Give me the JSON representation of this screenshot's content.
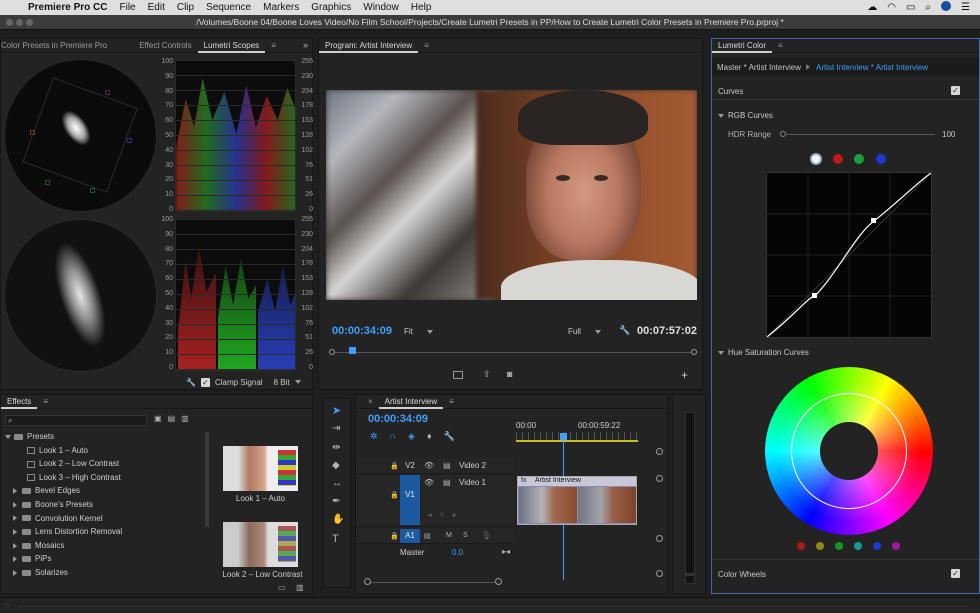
{
  "menubar": {
    "app": "Premiere Pro CC",
    "items": [
      "File",
      "Edit",
      "Clip",
      "Sequence",
      "Markers",
      "Graphics",
      "Window",
      "Help"
    ]
  },
  "titlebar": {
    "path": "/Volumes/Boone 04/Boone Loves Video/No Film School/Projects/Create Lumetri Presets in PP/How to Create Lumetri Color Presets in Premiere Pro.prproj *"
  },
  "scopes": {
    "tabs": [
      "Color Presets in Premiere Pro",
      "Effect Controls",
      "Lumetri Scopes"
    ],
    "scale_left": [
      "100",
      "90",
      "80",
      "70",
      "60",
      "50",
      "40",
      "30",
      "20",
      "10",
      "0"
    ],
    "scale_right": [
      "255",
      "230",
      "204",
      "178",
      "153",
      "128",
      "102",
      "76",
      "51",
      "26",
      "0"
    ],
    "clamp_label": "Clamp Signal",
    "bit_depth": "8 Bit"
  },
  "program": {
    "title": "Program: Artist Interview",
    "timecode": "00:00:34:09",
    "fit": "Fit",
    "quality": "Full",
    "duration": "00:07:57:02"
  },
  "effects": {
    "title": "Effects",
    "tree": [
      {
        "label": "Presets",
        "type": "folder-open",
        "indent": 0
      },
      {
        "label": "Look 1 – Auto",
        "type": "preset",
        "indent": 1
      },
      {
        "label": "Look 2 – Low Contrast",
        "type": "preset",
        "indent": 1
      },
      {
        "label": "Look 3 – High Contrast",
        "type": "preset",
        "indent": 1
      },
      {
        "label": "Bevel Edges",
        "type": "folder",
        "indent": 0
      },
      {
        "label": "Boone's Presets",
        "type": "folder",
        "indent": 0
      },
      {
        "label": "Convolution Kernel",
        "type": "folder",
        "indent": 0
      },
      {
        "label": "Lens Distortion Removal",
        "type": "folder",
        "indent": 0
      },
      {
        "label": "Mosaics",
        "type": "folder",
        "indent": 0
      },
      {
        "label": "PiPs",
        "type": "folder",
        "indent": 0
      },
      {
        "label": "Solarizes",
        "type": "folder",
        "indent": 0
      }
    ],
    "thumbs": [
      "Look 1 – Auto",
      "Look 2 – Low Contrast"
    ]
  },
  "timeline": {
    "title": "Artist Interview",
    "timecode": "00:00:34:09",
    "ruler": [
      "00:00",
      "00:00:59:22"
    ],
    "tracks": [
      {
        "id": "V2",
        "name": "Video 2"
      },
      {
        "id": "V1",
        "name": "Video 1"
      },
      {
        "id": "A1",
        "name": ""
      }
    ],
    "master_label": "Master",
    "master_value": "0.0",
    "clip_label": "Artist Interview"
  },
  "lumetri": {
    "title": "Lumetri Color",
    "source_tab": "Master * Artist Interview",
    "seq_tab": "Artist Interview * Artist Interview",
    "curves_label": "Curves",
    "rgb_label": "RGB Curves",
    "hdr_label": "HDR Range",
    "hdr_value": "100",
    "hue_label": "Hue Saturation Curves",
    "wheels_label": "Color Wheels",
    "channel_colors": [
      "#ffffff",
      "#c01818",
      "#1aa03a",
      "#1a3ad0"
    ],
    "hue_dots": [
      "#b01818",
      "#8a8a10",
      "#109a20",
      "#109a9a",
      "#1a3ad0",
      "#a018a0"
    ]
  }
}
